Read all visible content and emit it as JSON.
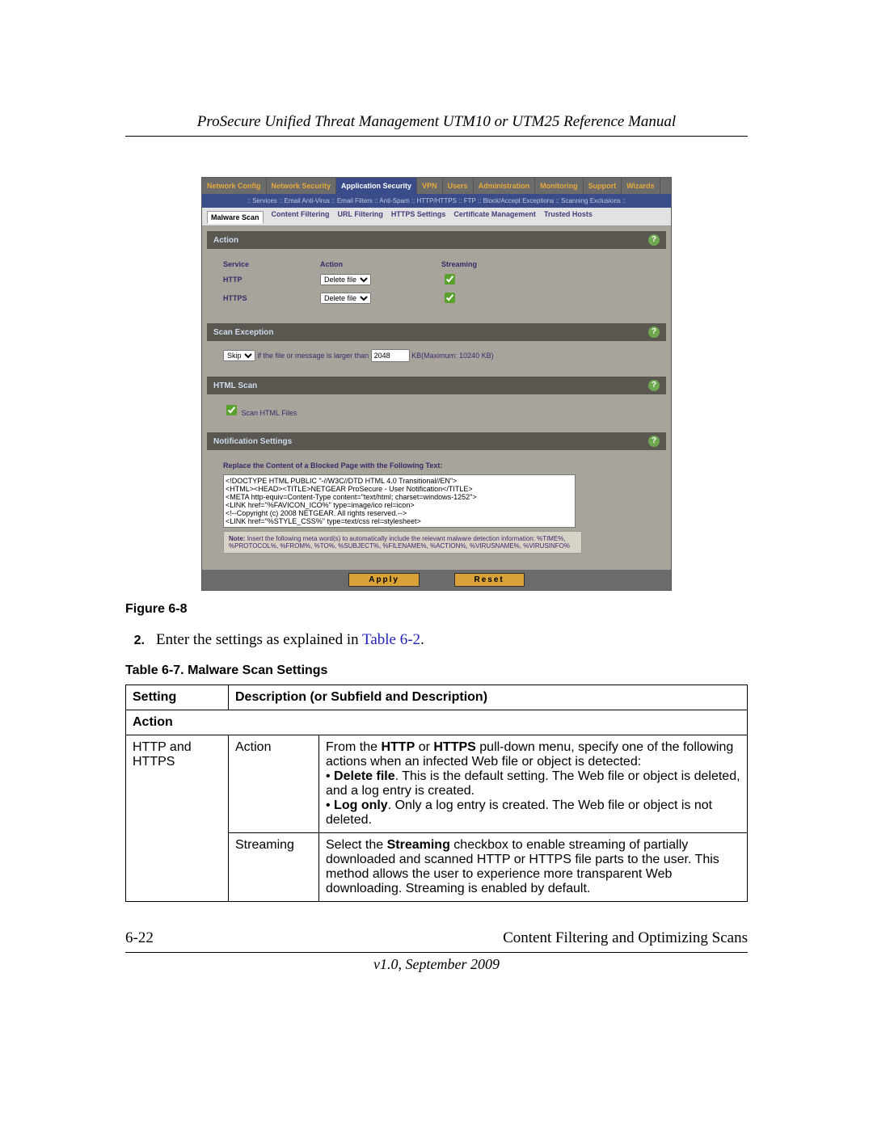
{
  "header": {
    "title": "ProSecure Unified Threat Management UTM10 or UTM25 Reference Manual"
  },
  "screenshot": {
    "tabs1": [
      "Network Config",
      "Network Security",
      "Application Security",
      "VPN",
      "Users",
      "Administration",
      "Monitoring",
      "Support",
      "Wizards"
    ],
    "tabs1_selected": "Application Security",
    "subbar": ":: Services :: Email Anti-Virus :: Email Filters :: Anti-Spam :: HTTP/HTTPS :: FTP :: Block/Accept Exceptions :: Scanning Exclusions ::",
    "subbar_hl": "HTTP/HTTPS",
    "tabs2": [
      "Malware Scan",
      "Content Filtering",
      "URL Filtering",
      "HTTPS Settings",
      "Certificate Management",
      "Trusted Hosts"
    ],
    "tabs2_selected": "Malware Scan",
    "action_section": {
      "title": "Action",
      "headers": {
        "service": "Service",
        "action": "Action",
        "streaming": "Streaming"
      },
      "rows": [
        {
          "service": "HTTP",
          "action": "Delete file",
          "streaming": true
        },
        {
          "service": "HTTPS",
          "action": "Delete file",
          "streaming": true
        }
      ]
    },
    "scan_exception": {
      "title": "Scan Exception",
      "skip_select": "Skip",
      "text_mid": "if the file or message is larger than",
      "value": "2048",
      "suffix": "KB(Maximum: 10240 KB)"
    },
    "html_scan": {
      "title": "HTML Scan",
      "checkbox_label": "Scan HTML Files",
      "checked": true
    },
    "notification": {
      "title": "Notification Settings",
      "replace_label": "Replace the Content of a Blocked Page with the Following Text:",
      "textarea": "<!DOCTYPE HTML PUBLIC \"-//W3C//DTD HTML 4.0 Transitional//EN\">\n<HTML><HEAD><TITLE>NETGEAR ProSecure - User Notification</TITLE>\n<META http-equiv=Content-Type content=\"text/html; charset=windows-1252\">\n<LINK href=\"%FAVICON_ICO%\" type=image/ico rel=icon>\n<!--Copyright (c) 2008 NETGEAR. All rights reserved.-->\n<LINK href=\"%STYLE_CSS%\" type=text/css rel=stylesheet>",
      "note_label": "Note:",
      "note_body": "Insert the following meta word(s) to automatically include the relevant malware detection information:\n%TIME%, %PROTOCOL%, %FROM%, %TO%, %SUBJECT%, %FILENAME%, %ACTION%, %VIRUSNAME%, %VIRUSINFO%"
    },
    "buttons": {
      "apply": "Apply",
      "reset": "Reset"
    }
  },
  "figure_caption": "Figure 6-8",
  "step": {
    "num": "2.",
    "text_pre": "Enter the settings as explained in ",
    "link": "Table 6-2",
    "text_post": "."
  },
  "table_caption": "Table 6-7. Malware Scan Settings",
  "table": {
    "head": {
      "setting": "Setting",
      "desc": "Description (or Subfield and Description)"
    },
    "section_row": "Action",
    "r1_c1": "HTTP and HTTPS",
    "r1_c2": "Action",
    "r1_c3_l1_pre": "From the ",
    "r1_c3_l1_b1": "HTTP",
    "r1_c3_l1_mid": " or ",
    "r1_c3_l1_b2": "HTTPS",
    "r1_c3_l1_post": " pull-down menu, specify one of the following actions when an infected Web file or object is detected:",
    "r1_bullet1_b": "Delete file",
    "r1_bullet1_t": ". This is the default setting. The Web file or object is deleted, and a log entry is created.",
    "r1_bullet2_b": "Log only",
    "r1_bullet2_t": ". Only a log entry is created. The Web file or object is not deleted.",
    "r2_c2": "Streaming",
    "r2_c3_pre": "Select the ",
    "r2_c3_b": "Streaming",
    "r2_c3_post": " checkbox to enable streaming of partially downloaded and scanned HTTP or HTTPS file parts to the user. This method allows the user to experience more transparent Web downloading. Streaming is enabled by default."
  },
  "footer": {
    "left": "6-22",
    "right": "Content Filtering and Optimizing Scans",
    "version": "v1.0, September 2009"
  }
}
